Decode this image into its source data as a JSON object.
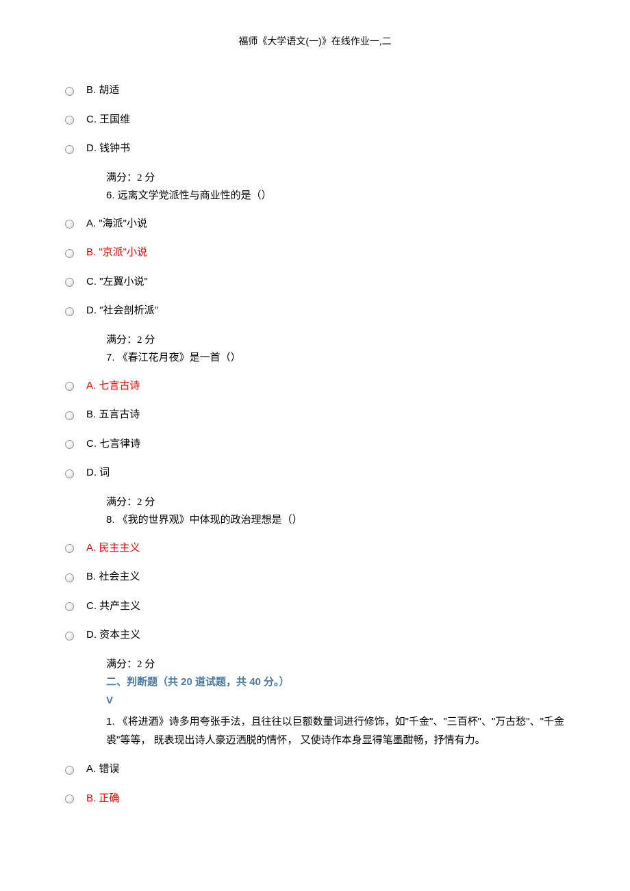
{
  "header": {
    "title": "福师《大学语文(一)》在线作业一,二"
  },
  "q5": {
    "optB": "B. 胡适",
    "optC": "C. 王国维",
    "optD": "D. 钱钟书"
  },
  "score_5": "满分：2  分",
  "q6": {
    "stem": "6.  远离文学党派性与商业性的是（）",
    "optA": "A. \"海派\"小说",
    "optB": "B. \"京派\"小说",
    "optC": "C. \"左翼小说\"",
    "optD": "D. \"社会剖析派\""
  },
  "score_6": "满分：2  分",
  "q7": {
    "stem": "7.  《春江花月夜》是一首（）",
    "optA": "A. 七言古诗",
    "optB": "B. 五言古诗",
    "optC": "C. 七言律诗",
    "optD": "D. 词"
  },
  "score_7": "满分：2  分",
  "q8": {
    "stem": "8.  《我的世界观》中体现的政治理想是（）",
    "optA": "A. 民主主义",
    "optB": "B. 社会主义",
    "optC": "C. 共产主义",
    "optD": "D. 资本主义"
  },
  "score_8": "满分：2  分",
  "section2": {
    "title": "二、判断题（共 20 道试题，共 40 分。）",
    "mark": "V"
  },
  "tf1": {
    "stem": "1.  《将进酒》诗多用夸张手法，且往往以巨额数量词进行修饰，如\"千金\"、\"三百杯\"、\"万古愁\"、\"千金裘\"等等， 既表现出诗人豪迈洒脱的情怀， 又使诗作本身显得笔墨酣畅，抒情有力。",
    "optA": "A. 错误",
    "optB": "B.  正确"
  }
}
